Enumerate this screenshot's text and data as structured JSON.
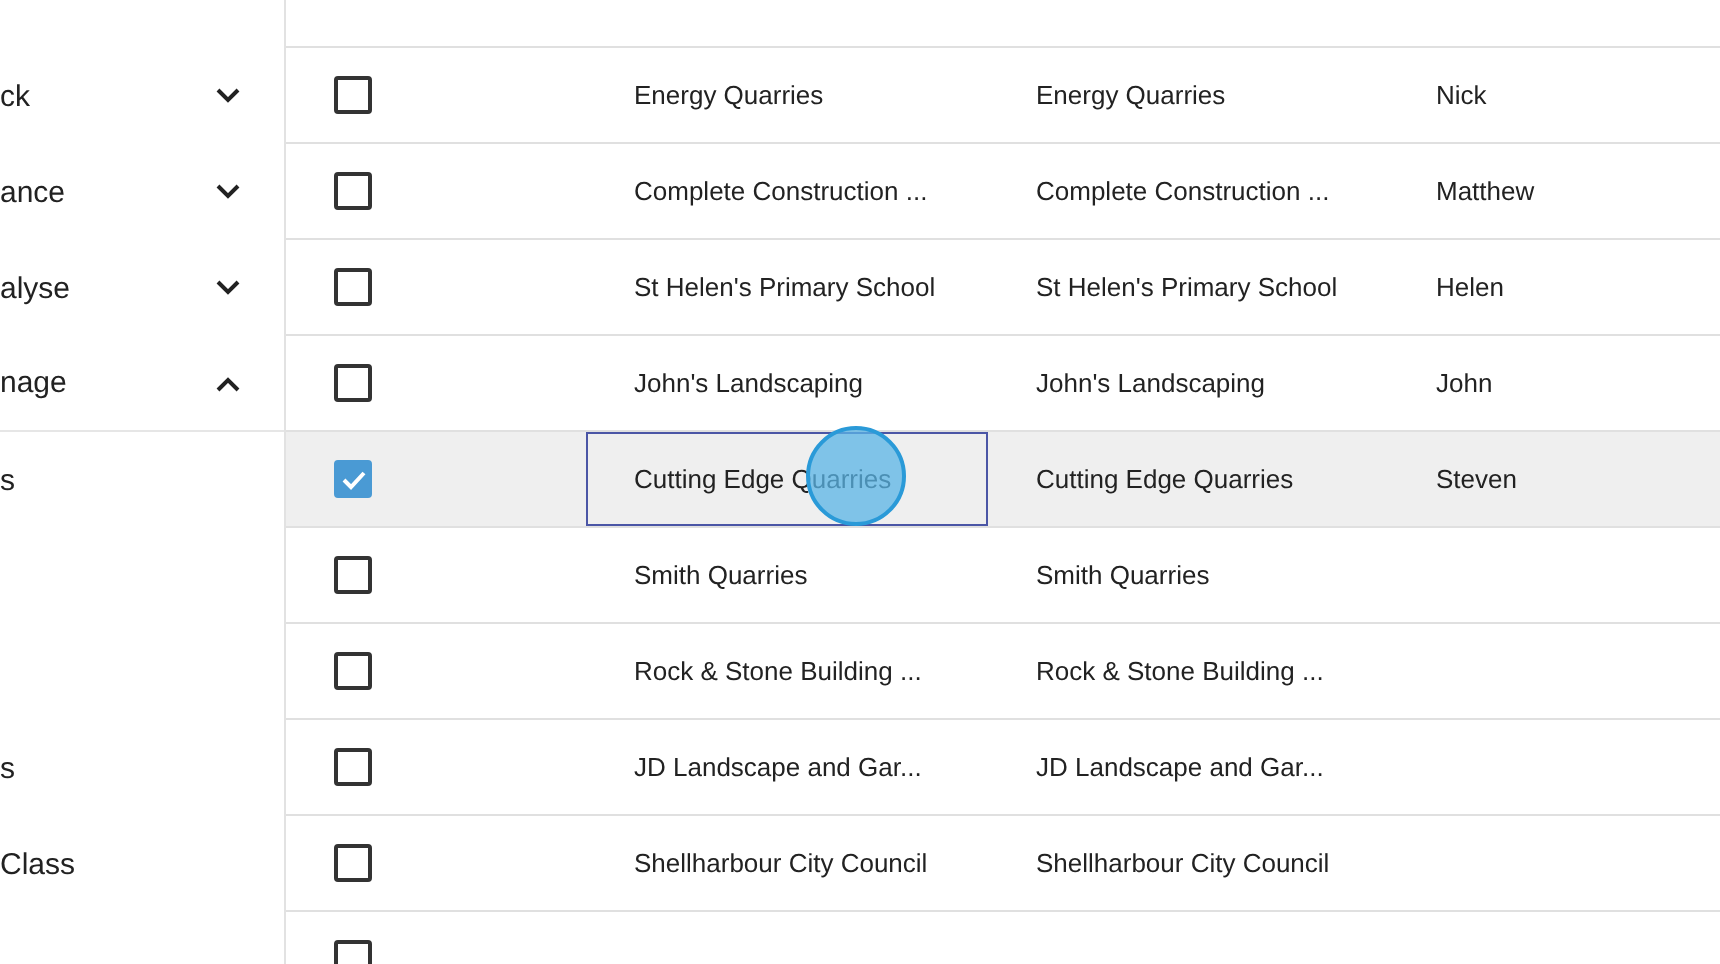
{
  "sidebar": {
    "items": [
      {
        "label": "ck",
        "expanded": false
      },
      {
        "label": "ance",
        "expanded": false
      },
      {
        "label": "alyse",
        "expanded": false
      },
      {
        "label": "nage",
        "expanded": true,
        "children": [
          {
            "label": "s"
          },
          {
            "label": "s"
          },
          {
            "label": "Class"
          }
        ]
      }
    ]
  },
  "table": {
    "rows": [
      {
        "selected": false,
        "cells": [
          {
            "text": "Energy Quarries",
            "focused": false
          },
          {
            "text": "Energy Quarries",
            "focused": false
          },
          {
            "text": "Nick",
            "focused": false
          }
        ]
      },
      {
        "selected": false,
        "cells": [
          {
            "text": "Complete Construction ...",
            "focused": false
          },
          {
            "text": "Complete Construction ...",
            "focused": false
          },
          {
            "text": "Matthew",
            "focused": false
          }
        ]
      },
      {
        "selected": false,
        "cells": [
          {
            "text": "St Helen's Primary School",
            "focused": false
          },
          {
            "text": "St Helen's Primary School",
            "focused": false
          },
          {
            "text": "Helen",
            "focused": false
          }
        ]
      },
      {
        "selected": false,
        "cells": [
          {
            "text": "John's Landscaping",
            "focused": false
          },
          {
            "text": "John's Landscaping",
            "focused": false
          },
          {
            "text": "John",
            "focused": false
          }
        ]
      },
      {
        "selected": true,
        "cells": [
          {
            "text": "Cutting Edge Quarries",
            "focused": true
          },
          {
            "text": "Cutting Edge Quarries",
            "focused": false
          },
          {
            "text": "Steven",
            "focused": false
          }
        ]
      },
      {
        "selected": false,
        "cells": [
          {
            "text": "Smith Quarries",
            "focused": false
          },
          {
            "text": "Smith Quarries",
            "focused": false
          }
        ]
      },
      {
        "selected": false,
        "cells": [
          {
            "text": "Rock & Stone Building ...",
            "focused": false
          },
          {
            "text": "Rock & Stone Building ...",
            "focused": false
          }
        ]
      },
      {
        "selected": false,
        "cells": [
          {
            "text": "JD Landscape and Gar...",
            "focused": false
          },
          {
            "text": "JD Landscape and Gar...",
            "focused": false
          }
        ]
      },
      {
        "selected": false,
        "cells": [
          {
            "text": "Shellharbour City Council",
            "focused": false
          },
          {
            "text": "Shellharbour City Council",
            "focused": false
          }
        ]
      },
      {
        "selected": false
      }
    ]
  }
}
